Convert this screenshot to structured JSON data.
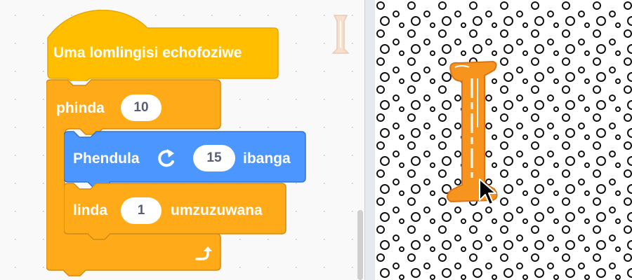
{
  "code_area": {
    "hat_block": {
      "label": "Uma lomlingisi echofoziwe"
    },
    "repeat_block": {
      "label": "phinda",
      "count": "10"
    },
    "turn_block": {
      "label": "Phendula",
      "icon": "rotate-right-icon",
      "degrees": "15",
      "unit": "ibanga"
    },
    "wait_block": {
      "label": "linda",
      "seconds": "1",
      "unit": "umzuzuwana"
    },
    "loop_icon": "loop-arrow-icon",
    "sprite_thumbnail_icon": "letter-i-sprite-icon"
  },
  "stage": {
    "backdrop": "polka-dots",
    "sprite_icon": "letter-i-sprite-icon",
    "cursor_icon": "mouse-pointer-icon"
  },
  "colors": {
    "events": "#ffbf00",
    "control": "#ffab19",
    "motion": "#4c97ff",
    "sprite_orange": "#f7941d"
  }
}
